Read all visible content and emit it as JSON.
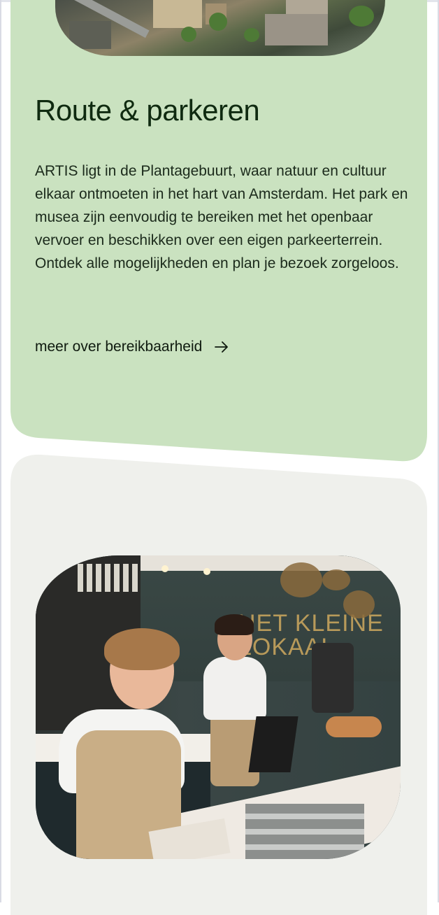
{
  "route": {
    "title": "Route & parkeren",
    "body": "ARTIS ligt in de Plantagebuurt, waar natuur en cultuur elkaar ontmoeten in het hart van Amsterdam. Het park en musea zijn eenvoudig te bereiken met het openbaar vervoer en beschikken over een eigen parkeerterrein. Ontdek alle mogelijkheden en plan je bezoek zorgeloos.",
    "link_label": "meer over bereikbaarheid",
    "link_icon": "arrow-right-icon",
    "image": "aerial-view-image"
  },
  "food": {
    "image": "cafe-staff-image",
    "image_sign_text": "HET KLEINE LOKAAL"
  },
  "colors": {
    "route_card_bg": "#cae2c0",
    "food_card_bg": "#eff0ec",
    "title_color": "#0f2a10",
    "text_color": "#1b2a1b"
  }
}
